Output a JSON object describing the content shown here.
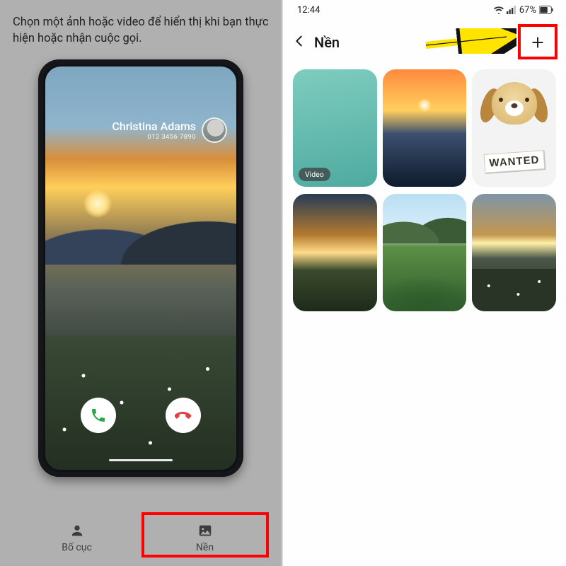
{
  "left": {
    "instruction": "Chọn một ảnh hoặc video để hiển thị khi bạn thực hiện hoặc nhận cuộc gọi.",
    "caller": {
      "name": "Christina Adams",
      "number": "012 3456 7890"
    },
    "nav": {
      "layout_label": "Bố cục",
      "background_label": "Nền"
    }
  },
  "right": {
    "status": {
      "time": "12:44",
      "battery_text": "67%"
    },
    "header_title": "Nền",
    "video_badge": "Video",
    "wanted_text": "WANTED"
  }
}
